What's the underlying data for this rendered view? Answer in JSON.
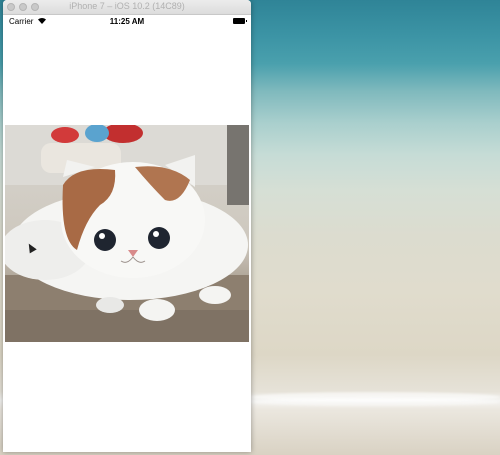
{
  "window": {
    "title": "iPhone 7 – iOS 10.2 (14C89)"
  },
  "statusbar": {
    "carrier": "Carrier",
    "time": "11:25 AM"
  },
  "colors": {
    "sea": "#3c94a5",
    "sand": "#e0dccd",
    "window_bg": "#ffffff"
  },
  "icons": [
    "close-button",
    "minimize-button",
    "zoom-button",
    "wifi-icon",
    "battery-icon",
    "mouse-cursor-icon"
  ]
}
